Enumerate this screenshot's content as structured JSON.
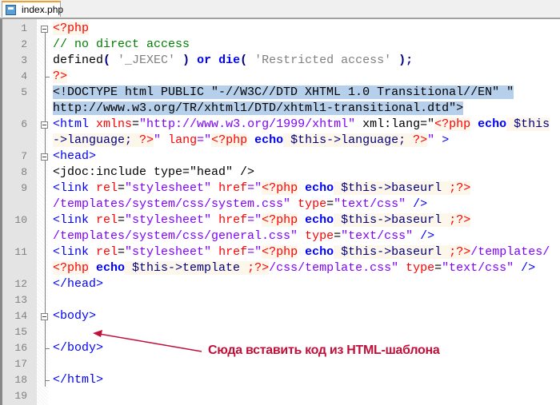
{
  "tab": {
    "title": "index.php",
    "icon": "file-icon"
  },
  "annotation": {
    "text": "Сюда вставить код из HTML-шаблона",
    "color": "#c0103a"
  },
  "rows": [
    {
      "n": "1",
      "seg": [
        {
          "t": "<?php",
          "k": "php"
        }
      ]
    },
    {
      "n": "2",
      "seg": [
        {
          "t": "// no direct access",
          "k": "cmt"
        }
      ]
    },
    {
      "n": "3",
      "seg": [
        {
          "t": "defined",
          "k": "txt"
        },
        {
          "t": "( ",
          "k": "op"
        },
        {
          "t": "'_JEXEC'",
          "k": "sq"
        },
        {
          "t": " ) ",
          "k": "op"
        },
        {
          "t": "or",
          "k": "kw"
        },
        {
          "t": " ",
          "k": "txt"
        },
        {
          "t": "die",
          "k": "kw"
        },
        {
          "t": "( ",
          "k": "op"
        },
        {
          "t": "'Restricted access'",
          "k": "sq"
        },
        {
          "t": " );",
          "k": "op"
        }
      ]
    },
    {
      "n": "4",
      "seg": [
        {
          "t": "?>",
          "k": "php"
        }
      ]
    },
    {
      "n": "5",
      "seg": [
        {
          "t": "<!DOCTYPE html PUBLIC \"-//W3C//DTD XHTML 1.0 Transitional//EN\" \"",
          "k": "sel"
        }
      ]
    },
    {
      "n": "",
      "seg": [
        {
          "t": "http://www.w3.org/TR/xhtml1/DTD/xhtml1-transitional.dtd\">",
          "k": "sel"
        }
      ]
    },
    {
      "n": "6",
      "seg": [
        {
          "t": "<html ",
          "k": "tag"
        },
        {
          "t": "xmlns",
          "k": "attr"
        },
        {
          "t": "=",
          "k": "txt"
        },
        {
          "t": "\"http://www.w3.org/1999/xhtml\"",
          "k": "str"
        },
        {
          "t": " xml:lang=\"",
          "k": "txt"
        },
        {
          "t": "<?php",
          "k": "php"
        },
        {
          "t": " echo",
          "k": "kw"
        },
        {
          "t": " $this",
          "k": "var"
        }
      ]
    },
    {
      "n": "",
      "seg": [
        {
          "t": "->language; ",
          "k": "var"
        },
        {
          "t": "?>",
          "k": "php"
        },
        {
          "t": "\" ",
          "k": "str"
        },
        {
          "t": "lang",
          "k": "attr"
        },
        {
          "t": "=\"",
          "k": "str"
        },
        {
          "t": "<?php",
          "k": "php"
        },
        {
          "t": " echo",
          "k": "kw"
        },
        {
          "t": " $this->language; ",
          "k": "var"
        },
        {
          "t": "?>",
          "k": "php"
        },
        {
          "t": "\" ",
          "k": "str"
        },
        {
          "t": ">",
          "k": "tag"
        }
      ]
    },
    {
      "n": "7",
      "seg": [
        {
          "t": "<head>",
          "k": "tag"
        }
      ]
    },
    {
      "n": "8",
      "seg": [
        {
          "t": "<jdoc:include type=\"head\" />",
          "k": "txt"
        }
      ]
    },
    {
      "n": "9",
      "seg": [
        {
          "t": "<link ",
          "k": "tag"
        },
        {
          "t": "rel",
          "k": "attr"
        },
        {
          "t": "=",
          "k": "txt"
        },
        {
          "t": "\"stylesheet\"",
          "k": "str"
        },
        {
          "t": " ",
          "k": "txt"
        },
        {
          "t": "href",
          "k": "attr"
        },
        {
          "t": "=\"",
          "k": "str"
        },
        {
          "t": "<?php",
          "k": "php"
        },
        {
          "t": " echo",
          "k": "kw"
        },
        {
          "t": " $this->baseurl ",
          "k": "var"
        },
        {
          "t": ";?>",
          "k": "php"
        }
      ]
    },
    {
      "n": "",
      "seg": [
        {
          "t": "/templates/system/css/system.css\"",
          "k": "str"
        },
        {
          "t": " ",
          "k": "txt"
        },
        {
          "t": "type",
          "k": "attr"
        },
        {
          "t": "=",
          "k": "txt"
        },
        {
          "t": "\"text/css\"",
          "k": "str"
        },
        {
          "t": " />",
          "k": "tag"
        }
      ]
    },
    {
      "n": "10",
      "seg": [
        {
          "t": "<link ",
          "k": "tag"
        },
        {
          "t": "rel",
          "k": "attr"
        },
        {
          "t": "=",
          "k": "txt"
        },
        {
          "t": "\"stylesheet\"",
          "k": "str"
        },
        {
          "t": " ",
          "k": "txt"
        },
        {
          "t": "href",
          "k": "attr"
        },
        {
          "t": "=\"",
          "k": "str"
        },
        {
          "t": "<?php",
          "k": "php"
        },
        {
          "t": " echo",
          "k": "kw"
        },
        {
          "t": " $this->baseurl ",
          "k": "var"
        },
        {
          "t": ";?>",
          "k": "php"
        }
      ]
    },
    {
      "n": "",
      "seg": [
        {
          "t": "/templates/system/css/general.css\"",
          "k": "str"
        },
        {
          "t": " ",
          "k": "txt"
        },
        {
          "t": "type",
          "k": "attr"
        },
        {
          "t": "=",
          "k": "txt"
        },
        {
          "t": "\"text/css\"",
          "k": "str"
        },
        {
          "t": " />",
          "k": "tag"
        }
      ]
    },
    {
      "n": "11",
      "seg": [
        {
          "t": "<link ",
          "k": "tag"
        },
        {
          "t": "rel",
          "k": "attr"
        },
        {
          "t": "=",
          "k": "txt"
        },
        {
          "t": "\"stylesheet\"",
          "k": "str"
        },
        {
          "t": " ",
          "k": "txt"
        },
        {
          "t": "href",
          "k": "attr"
        },
        {
          "t": "=\"",
          "k": "str"
        },
        {
          "t": "<?php",
          "k": "php"
        },
        {
          "t": " echo",
          "k": "kw"
        },
        {
          "t": " $this->baseurl ",
          "k": "var"
        },
        {
          "t": ";?>",
          "k": "php"
        },
        {
          "t": "/templates/",
          "k": "str"
        }
      ]
    },
    {
      "n": "",
      "seg": [
        {
          "t": "<?php",
          "k": "php"
        },
        {
          "t": " echo",
          "k": "kw"
        },
        {
          "t": " $this->template ",
          "k": "var"
        },
        {
          "t": ";?>",
          "k": "php"
        },
        {
          "t": "/css/template.css\"",
          "k": "str"
        },
        {
          "t": " ",
          "k": "txt"
        },
        {
          "t": "type",
          "k": "attr"
        },
        {
          "t": "=",
          "k": "txt"
        },
        {
          "t": "\"text/css\"",
          "k": "str"
        },
        {
          "t": " />",
          "k": "tag"
        }
      ]
    },
    {
      "n": "12",
      "seg": [
        {
          "t": "</head>",
          "k": "tag"
        }
      ]
    },
    {
      "n": "13",
      "seg": []
    },
    {
      "n": "14",
      "seg": [
        {
          "t": "<body>",
          "k": "tag"
        }
      ]
    },
    {
      "n": "15",
      "seg": []
    },
    {
      "n": "16",
      "seg": [
        {
          "t": "</body>",
          "k": "tag"
        }
      ]
    },
    {
      "n": "17",
      "seg": []
    },
    {
      "n": "18",
      "seg": [
        {
          "t": "</html>",
          "k": "tag"
        }
      ]
    },
    {
      "n": "19",
      "seg": []
    }
  ]
}
